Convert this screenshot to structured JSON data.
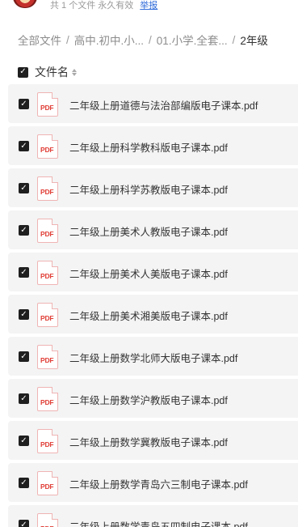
{
  "top": {
    "meta_text": "共 1 个文件  永久有效",
    "report_link": "举报"
  },
  "breadcrumb": [
    "全部文件",
    "高中.初中.小...",
    "01.小学.全套...",
    "2年级"
  ],
  "list_header": {
    "title": "文件名"
  },
  "pdf_badge": "PDF",
  "files": [
    "二年级上册道德与法治部编版电子课本.pdf",
    "二年级上册科学教科版电子课本.pdf",
    "二年级上册科学苏教版电子课本.pdf",
    "二年级上册美术人教版电子课本.pdf",
    "二年级上册美术人美版电子课本.pdf",
    "二年级上册美术湘美版电子课本.pdf",
    "二年级上册数学北师大版电子课本.pdf",
    "二年级上册数学沪教版电子课本.pdf",
    "二年级上册数学冀教版电子课本.pdf",
    "二年级上册数学青岛六三制电子课本.pdf",
    "二年级上册数学青岛五四制电子课本.pdf"
  ],
  "colors": {
    "row_bg": "#f4f4f4",
    "pdf_red": "#e03e36",
    "link_blue": "#2f6bd9"
  }
}
